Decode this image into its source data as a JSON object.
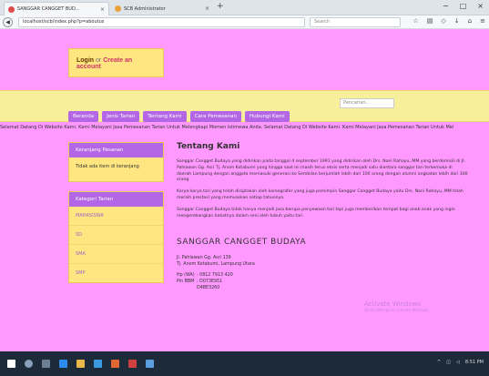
{
  "browser": {
    "tabs": [
      {
        "title": "SANGGAR CANGGET BUD...",
        "close": "×"
      },
      {
        "title": "SCB Administrator",
        "close": "×"
      }
    ],
    "new_tab": "+",
    "window_controls": [
      "−",
      "□",
      "×"
    ],
    "url": "localhost/scb/index.php?p=aboutus",
    "search_placeholder": "Search",
    "back": "◀"
  },
  "header": {
    "login": "Login",
    "or": "or",
    "create": "Create an account",
    "search_placeholder": "Pencarian.."
  },
  "menu": [
    "Beranda",
    "Jenis Tarian",
    "Tentang Kami",
    "Cara Pemesanan",
    "Hubungi Kami"
  ],
  "marquee": "Selamat Datang Di Website Kami. Kami Melayani Jasa Pemesanan Tarian Untuk Melengkapi Momen Istimewa Anda. Selamat Datang Di Website Kami. Kami Melayani Jasa Pemesanan Tarian Untuk Mel",
  "sidebar": {
    "cart_title": "Keranjang Pesanan",
    "cart_empty": "Tidak ada item di keranjang",
    "category_title": "Kategori Tarian",
    "categories": [
      "MAHASISWA",
      "SD",
      "SMA",
      "SMP"
    ]
  },
  "content": {
    "title": "Tentang Kami",
    "p1": "Sanggar Cangget Budaya yang didirikan pada tanggal 4 september 1991 yang didirikan oleh Drs. Nani Rahayu,.MM yang berdomisili di Jl. Pahlawan Gg. Asri Tj. Anom Kotabumi yang hingga saat ini masih terus eksis serta menjadi satu diantara sanggar tari terkemuka di daerah Lampung dengan anggota memasuki generasi ke Sembilan berjumlah lebih dari 100 orang dengan alumni angkatan lebih dari 300 orang.",
    "p2": "Karya-karya tari yang telah diciptakan oleh koreografer yang juga pemimpin Sanggar Cangget Budaya yaitu Drs. Nani Rahayu,.MM telah meraih prestasi yang memuaskan setiap tahunnya.",
    "p3": "Sanggar Cangget Budaya tidak hanya menjadi jasa berupa penyewaan tari tapi juga memberikan tempat bagi anak-anak yang ingin mengembangkan bakatnya dalam seni oleh tubuh yaitu tari.",
    "org_name": "SANGGAR CANGGET BUDAYA",
    "address1": "Jl. Pahlawan Gg. Asri 139",
    "address2": "Tj. Anom Kotabumi, Lampung Utara",
    "contacts": [
      {
        "label": "Hp (WA)",
        "value": ": 0812 7913 420"
      },
      {
        "label": "Pin BBM",
        "value": ": D073E951"
      },
      {
        "label": "",
        "value": "  D4BE3260"
      }
    ]
  },
  "watermark": {
    "title": "Activate Windows",
    "sub": "Go to Settings to activate Windows."
  },
  "taskbar": {
    "time": "8:51 PM"
  }
}
